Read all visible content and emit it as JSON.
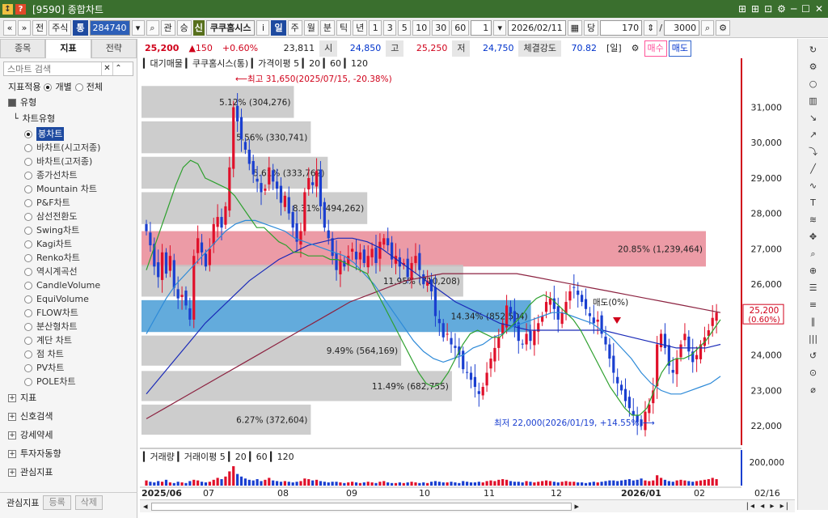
{
  "window": {
    "id": "[9590]",
    "title": "종합차트",
    "right_icons": [
      "⊞",
      "⊞",
      "⊡",
      "⚙",
      "─",
      "☐",
      "✕"
    ]
  },
  "toolbar": {
    "nav_prev": "«",
    "nav_next": "»",
    "jeon": "전",
    "jusik": "주식",
    "tong": "통",
    "code": "284740",
    "search": "⌕",
    "gwan": "관",
    "seung": "승",
    "shin": "신",
    "stock_name": "쿠쿠홈시스",
    "info": "i",
    "periods": [
      "일",
      "주",
      "월",
      "분",
      "틱",
      "년"
    ],
    "period_selected": "일",
    "nums": [
      "1",
      "3",
      "5",
      "10",
      "30",
      "60"
    ],
    "unit": "1",
    "date": "2026/02/11",
    "dang": "당",
    "count": "170",
    "zoom": "3000"
  },
  "left": {
    "tabs": [
      "종목",
      "지표",
      "전략"
    ],
    "active_tab": "지표",
    "search_placeholder": "스마트 검색",
    "apply_label": "지표적용",
    "opt_each": "개별",
    "opt_all": "전체",
    "section_type": "유형",
    "chart_type_header": "차트유형",
    "chart_types": [
      "봉차트",
      "바차트(시고저종)",
      "바차트(고저종)",
      "종가선차트",
      "Mountain 차트",
      "P&F차트",
      "삼선전환도",
      "Swing차트",
      "Kagi차트",
      "Renko차트",
      "역시계곡선",
      "CandleVolume",
      "EquiVolume",
      "FLOW차트",
      "분산형차트",
      "계단 차트",
      "점 차트",
      "PV차트",
      "POLE차트"
    ],
    "selected_chart": "봉차트",
    "sections": [
      "지표",
      "신호검색",
      "강세약세",
      "투자자동향",
      "관심지표"
    ],
    "bottom_label": "관심지표",
    "btn_register": "등록",
    "btn_delete": "삭제"
  },
  "infobar": {
    "price": "25,200",
    "change": "▲150",
    "pct": "+0.60%",
    "volume": "23,811",
    "open_lbl": "시",
    "open": "24,850",
    "high_lbl": "고",
    "high": "25,250",
    "low_lbl": "저",
    "low": "24,750",
    "strength_lbl": "체결강도",
    "strength": "70.82",
    "period_tag": "[일]",
    "buy": "매수",
    "sell": "매도"
  },
  "legend": {
    "main": "대기매물",
    "name": "쿠쿠홈시스(통)",
    "ma_label": "가격이평",
    "ma_periods": [
      "5",
      "20",
      "60",
      "120"
    ],
    "vol_name": "거래량",
    "vol_ma_label": "거래이평",
    "vol_ma_periods": [
      "5",
      "20",
      "60",
      "120"
    ]
  },
  "colors": {
    "ma5": "#2ea02e",
    "ma20": "#2d8ad8",
    "ma60": "#1a2ab8",
    "ma120": "#8c2240",
    "up": "#e0102a",
    "down": "#1a3fd0",
    "resist": "#e57a88",
    "support": "#2f8fd0",
    "gray_bar": "#c4c4c4"
  },
  "chart_data": {
    "type": "candlestick",
    "yaxis_ticks": [
      22000,
      23000,
      24000,
      25000,
      26000,
      27000,
      28000,
      29000,
      30000,
      31000
    ],
    "ylim": [
      21500,
      32200
    ],
    "volume_tick": "200,000",
    "current_price": "25,200",
    "current_pct": "(0.60%)",
    "xlabels": [
      "2025/06",
      "07",
      "08",
      "09",
      "10",
      "11",
      "12",
      "2026/01",
      "02",
      "02/16"
    ],
    "high_annot": "최고 31,650(2025/07/15, -20.38%)",
    "low_annot": "최저 22,000(2026/01/19, +14.55%)",
    "mid_annot": "매도(0%)",
    "volume_profile": [
      {
        "lo": 30700,
        "hi": 31600,
        "pct": "5.12%",
        "vol": "(304,276)",
        "w": 0.27
      },
      {
        "lo": 29700,
        "hi": 30600,
        "pct": "5.56%",
        "vol": "(330,741)",
        "w": 0.3
      },
      {
        "lo": 28700,
        "hi": 29600,
        "pct": "5.61%",
        "vol": "(333,762)",
        "w": 0.33
      },
      {
        "lo": 27700,
        "hi": 28600,
        "pct": "8.31%",
        "vol": "(494,262)",
        "w": 0.4
      },
      {
        "lo": 26500,
        "hi": 27500,
        "pct": "20.85%",
        "vol": "(1,239,464)",
        "w": 1.0,
        "hl": "resist"
      },
      {
        "lo": 25650,
        "hi": 26550,
        "pct": "11.95%",
        "vol": "(710,208)",
        "w": 0.57
      },
      {
        "lo": 24650,
        "hi": 25550,
        "pct": "14.34%",
        "vol": "(852,504)",
        "w": 0.69,
        "hl": "support"
      },
      {
        "lo": 23700,
        "hi": 24550,
        "pct": "9.49%",
        "vol": "(564,169)",
        "w": 0.46
      },
      {
        "lo": 22700,
        "hi": 23550,
        "pct": "11.49%",
        "vol": "(682,755)",
        "w": 0.55
      },
      {
        "lo": 21750,
        "hi": 22600,
        "pct": "6.27%",
        "vol": "(372,604)",
        "w": 0.3
      }
    ],
    "closes": [
      27500,
      27100,
      26500,
      26200,
      26900,
      26300,
      26800,
      25900,
      25600,
      25700,
      25400,
      25000,
      26800,
      27300,
      26900,
      26500,
      27000,
      27700,
      27900,
      27600,
      28200,
      29300,
      31000,
      30600,
      30100,
      29800,
      29400,
      29100,
      28900,
      28600,
      28700,
      29300,
      28900,
      28700,
      28300,
      28500,
      28000,
      27600,
      27200,
      27500,
      28600,
      29000,
      28800,
      29200,
      28200,
      27600,
      27300,
      26800,
      26400,
      26700,
      26500,
      26800,
      27000,
      26700,
      26900,
      26600,
      26800,
      27000,
      26600,
      27200,
      27300,
      27100,
      26700,
      26800,
      26500,
      26600,
      26200,
      26600,
      26800,
      26400,
      26000,
      26100,
      25800,
      25100,
      24900,
      24500,
      24600,
      24300,
      24200,
      24000,
      23600,
      23500,
      23300,
      23100,
      22900,
      23100,
      23500,
      23900,
      24200,
      24500,
      24900,
      25400,
      25200,
      24800,
      24400,
      24300,
      24600,
      24400,
      24700,
      24900,
      25100,
      25500,
      25600,
      25300,
      25000,
      25200,
      25500,
      25800,
      25900,
      25700,
      25500,
      25300,
      25100,
      24900,
      25000,
      24600,
      24300,
      23900,
      23500,
      23200,
      23000,
      22700,
      22500,
      22300,
      22100,
      22000,
      22400,
      22600,
      23000,
      24300,
      24600,
      24200,
      23700,
      23500,
      23900,
      24300,
      24600,
      24100,
      23800,
      24000,
      24300,
      24500,
      24700,
      25050,
      25200
    ],
    "ma5": [
      26400,
      27000,
      27600,
      28200,
      28800,
      29300,
      29500,
      29400,
      29000,
      28900,
      28800,
      28700,
      28500,
      28200,
      27900,
      27600,
      27600,
      27400,
      27200,
      27100,
      26900,
      26900,
      26800,
      26800,
      26800,
      26700,
      26700,
      26600,
      26500,
      26400,
      26300,
      25900,
      25500,
      25100,
      24700,
      24300,
      23900,
      23500,
      23200,
      23100,
      23200,
      23500,
      23900,
      24300,
      24600,
      24700,
      24600,
      24500,
      24500,
      24700,
      24900,
      25100,
      25400,
      25600,
      25700,
      25600,
      25400,
      25200,
      25000,
      24700,
      24300,
      23900,
      23500,
      23100,
      22800,
      22500,
      22300,
      22300,
      22500,
      23000,
      23500,
      23800,
      23900,
      23900,
      24000,
      24200,
      24400,
      24700,
      25000
    ],
    "ma20": [
      24600,
      25100,
      25600,
      26000,
      26300,
      26600,
      26900,
      27200,
      27500,
      27700,
      27800,
      27800,
      27700,
      27600,
      27500,
      27300,
      27200,
      27100,
      27000,
      26900,
      26800,
      26600,
      26300,
      26000,
      25600,
      25200,
      24800,
      24400,
      24100,
      23900,
      23800,
      23900,
      24000,
      24200,
      24300,
      24500,
      24600,
      24800,
      24900,
      25000,
      25100,
      25200,
      25200,
      25100,
      25000,
      24900,
      24700,
      24500,
      24200,
      23900,
      23500,
      23200,
      23000,
      22900,
      22900,
      23000,
      23100,
      23200,
      23400
    ],
    "ma60": [
      22900,
      23400,
      23900,
      24400,
      24900,
      25300,
      25700,
      26100,
      26400,
      26700,
      26900,
      27100,
      27200,
      27300,
      27300,
      27200,
      27000,
      26700,
      26400,
      26100,
      25800,
      25500,
      25300,
      25100,
      24900,
      24800,
      24700,
      24700,
      24700,
      24700,
      24700,
      24700,
      24600,
      24500,
      24400,
      24300,
      24200,
      24200,
      24200,
      24300
    ],
    "ma120": [
      22200,
      22500,
      22800,
      23100,
      23400,
      23700,
      24000,
      24300,
      24600,
      24900,
      25200,
      25500,
      25700,
      25900,
      26100,
      26200,
      26300,
      26300,
      26300,
      26300,
      26300,
      26200,
      26100,
      26000,
      25900,
      25800,
      25700,
      25600,
      25500,
      25400,
      25300,
      25200
    ],
    "volumes": [
      8,
      6,
      5,
      7,
      6,
      9,
      5,
      4,
      6,
      5,
      4,
      7,
      9,
      8,
      6,
      5,
      6,
      9,
      12,
      10,
      14,
      22,
      30,
      18,
      14,
      11,
      9,
      8,
      10,
      7,
      9,
      12,
      8,
      7,
      6,
      7,
      6,
      5,
      6,
      7,
      11,
      10,
      8,
      9,
      7,
      6,
      5,
      6,
      6,
      5,
      4,
      5,
      6,
      5,
      4,
      5,
      6,
      5,
      4,
      6,
      7,
      5,
      4,
      4,
      5,
      4,
      5,
      6,
      5,
      4,
      5,
      4,
      6,
      7,
      6,
      5,
      5,
      6,
      5,
      4,
      7,
      6,
      5,
      5,
      6,
      5,
      7,
      8,
      7,
      9,
      10,
      9,
      7,
      6,
      6,
      5,
      7,
      6,
      5,
      6,
      7,
      8,
      7,
      6,
      5,
      6,
      7,
      6,
      6,
      5,
      5,
      4,
      5,
      6,
      5,
      6,
      7,
      8,
      8,
      7,
      8,
      9,
      10,
      8,
      9,
      11,
      8,
      7,
      8,
      16,
      12,
      9,
      7,
      6,
      8,
      9,
      8,
      7,
      6,
      7,
      8,
      9,
      10,
      12,
      10
    ]
  }
}
